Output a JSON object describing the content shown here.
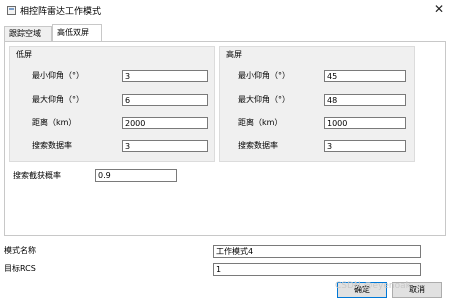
{
  "window": {
    "title": "相控阵雷达工作模式",
    "close_glyph": "✕"
  },
  "tabs": [
    {
      "label": "跟踪空域"
    },
    {
      "label": "高低双屏"
    }
  ],
  "low_screen": {
    "title": "低屏",
    "fields": [
      {
        "label": "最小仰角（°）",
        "value": "3"
      },
      {
        "label": "最大仰角（°）",
        "value": "6"
      },
      {
        "label": "距离（km）",
        "value": "2000"
      },
      {
        "label": "搜索数据率",
        "value": "3"
      }
    ]
  },
  "high_screen": {
    "title": "高屏",
    "fields": [
      {
        "label": "最小仰角（°）",
        "value": "45"
      },
      {
        "label": "最大仰角（°）",
        "value": "48"
      },
      {
        "label": "距离（km）",
        "value": "1000"
      },
      {
        "label": "搜索数据率",
        "value": "3"
      }
    ]
  },
  "capture_prob": {
    "label": "搜索截获概率",
    "value": "0.9"
  },
  "mode_name": {
    "label": "模式名称",
    "value": "工作模式4"
  },
  "target_rcs": {
    "label": "目标RCS",
    "value": "1"
  },
  "buttons": {
    "ok": "确定",
    "cancel": "取消"
  },
  "watermark": "CSDN @eyenoak"
}
